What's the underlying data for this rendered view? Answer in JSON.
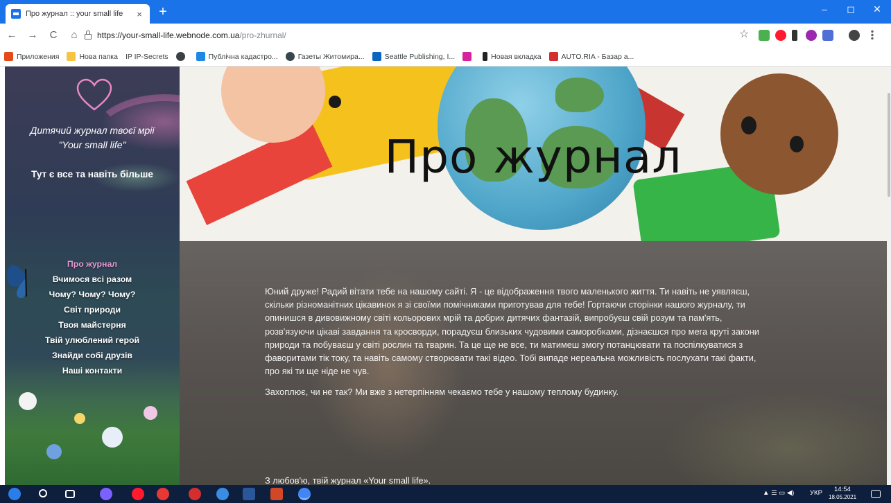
{
  "browser": {
    "tab_title": "Про журнал :: your small life",
    "tab_close": "×",
    "new_tab": "+",
    "url_host": "https://your-small-life.webnode.com.ua",
    "url_path": "/pro-zhurnal/",
    "window_controls": {
      "minimize": "–",
      "maximize": "◻",
      "close": "✕"
    },
    "nav": {
      "back": "←",
      "forward": "→",
      "reload": "C",
      "home": "⌂"
    },
    "star": "☆"
  },
  "bookmarks": [
    {
      "label": "Приложения",
      "color": "#e64a19"
    },
    {
      "label": "Нова папка",
      "color": "#f6c343"
    },
    {
      "label": "IP IP-Secrets",
      "color": "#444444"
    },
    {
      "label": "",
      "color": "#3c4043"
    },
    {
      "label": "Публічна кадастро...",
      "color": "#1e88e5"
    },
    {
      "label": "Газеты Житомира...",
      "color": "#37474f"
    },
    {
      "label": "Seattle Publishing, I...",
      "color": "#0a66c2"
    },
    {
      "label": "",
      "color": "#d6249f"
    },
    {
      "label": "Новая вкладка",
      "color": "#222222"
    },
    {
      "label": "AUTO.RIA - Базар а...",
      "color": "#d32f2f"
    }
  ],
  "sidebar": {
    "title": "Дитячий журнал твоєї мрії \"Your small life\"",
    "subtitle": "Тут є все та навіть більше",
    "menu": [
      {
        "label": "Про журнал",
        "active": true
      },
      {
        "label": "Вчимося всі разом",
        "active": false
      },
      {
        "label": "Чому? Чому? Чому?",
        "active": false
      },
      {
        "label": "Світ природи",
        "active": false
      },
      {
        "label": "Твоя майстерня",
        "active": false
      },
      {
        "label": "Твій улюблений герой",
        "active": false
      },
      {
        "label": "Знайди собі друзів",
        "active": false
      },
      {
        "label": "Наші контакти",
        "active": false
      }
    ]
  },
  "hero": {
    "title": "Про журнал"
  },
  "content": {
    "paragraph1": "Юний друже! Радий вітати тебе на нашому сайті. Я - це відображення твого маленького життя. Ти навіть не уявляєш, скільки різноманітних цікавинок я зі своїми помічниками приготував для тебе! Гортаючи сторінки нашого журналу, ти опинишся в дивовижному світі кольорових мрій та добрих дитячих фантазій, випробуєш свій розум та пам'ять, розв'язуючи цікаві завдання та кросворди, порадуєш близьких чудовими саморобками, дізнаєшся про мега круті закони природи та побуваєш у світі рослин та тварин. Та це ще не все, ти матимеш змогу потанцювати та поспілкуватися з фаворитами тік току, та навіть самому створювати такі відео. Тобі випаде нереальна можливість послухати такі факти, про які ти ще ніде не чув.",
    "paragraph2": "Захоплює, чи не так? Ми вже з нетерпінням чекаємо тебе у нашому теплому будинку.",
    "signature": "З любов'ю, твій журнал «Your small life»."
  },
  "taskbar": {
    "tray_lang": "УКР",
    "tray_time": "14:54",
    "tray_date": "18.05.2021"
  },
  "colors": {
    "chrome_blue": "#1a73e8",
    "menu_active": "#e69ad2",
    "taskbar": "#0e1f3d"
  }
}
